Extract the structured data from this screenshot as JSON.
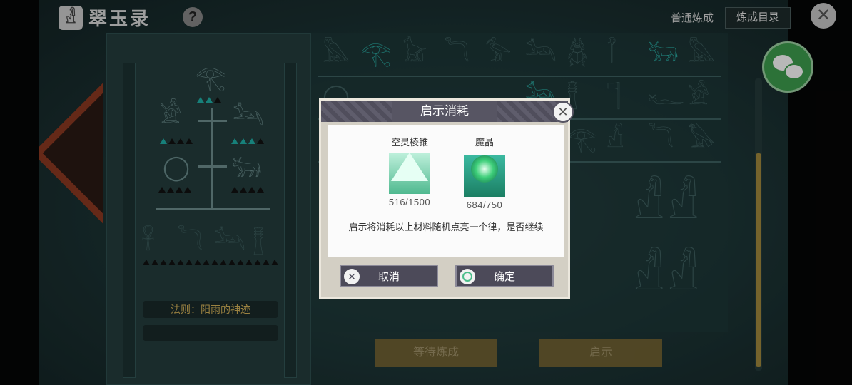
{
  "header": {
    "title": "翠玉录",
    "help_icon": "?",
    "tab_normal": "普通炼成",
    "tab_catalog": "炼成目录",
    "close_icon": "✕"
  },
  "left_panel": {
    "law_label": "法则：阳雨的神迹"
  },
  "actions": {
    "wait_label": "等待炼成",
    "reveal_label": "启示"
  },
  "dialog": {
    "title": "启示消耗",
    "close_icon": "✕",
    "items": [
      {
        "name": "空灵棱锥",
        "count": "516/1500",
        "icon": "pyramid-eye-icon"
      },
      {
        "name": "魔晶",
        "count": "684/750",
        "icon": "green-crystal-icon"
      }
    ],
    "message": "启示将消耗以上材料随机点亮一个律，是否继续",
    "cancel_label": "取消",
    "confirm_label": "确定"
  },
  "colors": {
    "accent_teal": "#20b2aa",
    "gold_text": "#d7b45a",
    "dialog_header": "#575563",
    "button_bg": "#4c4a59"
  }
}
